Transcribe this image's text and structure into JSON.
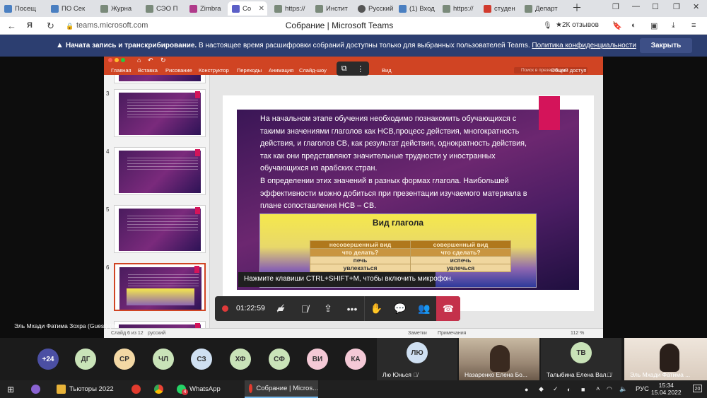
{
  "browser": {
    "tabs": [
      {
        "label": "Посещ",
        "color": "#4a7fc1"
      },
      {
        "label": "ПО Сек",
        "color": "#4a7fc1"
      },
      {
        "label": "Журна",
        "color": "#7a8a7a"
      },
      {
        "label": "СЭО П",
        "color": "#7a8a7a"
      },
      {
        "label": "Zimbra",
        "color": "#b03a8a"
      },
      {
        "label": "Со",
        "color": "#5b5fc7"
      },
      {
        "label": "https://",
        "color": "#7a8a7a"
      },
      {
        "label": "Инстит",
        "color": "#7a8a7a"
      },
      {
        "label": "Русский",
        "color": "#555"
      },
      {
        "label": "(1) Вход",
        "color": "#4a7fc1"
      },
      {
        "label": "https://",
        "color": "#7a8a7a"
      },
      {
        "label": "студен",
        "color": "#d13b2e"
      },
      {
        "label": "Департ",
        "color": "#7a8a7a"
      }
    ],
    "url": "teams.microsoft.com",
    "page_title": "Собрание | Microsoft Teams",
    "reviews": "★2К отзывов"
  },
  "banner": {
    "lead": "Начата запись и транскрибирование.",
    "text": " В настоящее время расшифровки собраний доступны только для выбранных пользователей Teams. ",
    "link": "Политика конфиденциальности",
    "close_label": "Закрыть"
  },
  "ppt": {
    "ribbon": [
      "Главная",
      "Вставка",
      "Рисование",
      "Конструктор",
      "Переходы",
      "Анимация",
      "Слайд-шоу",
      "Вид"
    ],
    "search_placeholder": "Поиск в презентации",
    "share_label": "Общий доступ",
    "thumb_numbers": [
      "3",
      "4",
      "5",
      "6"
    ],
    "slide_paragraphs": [
      "На начальном этапе обучения необходимо познакомить обучающихся с такими значениями глаголов как НСВ,процесс действия, многократность действия, и глаголов СВ, как результат действия, однократность действия, так как они представляют значительные трудности у иностранных обучающихся из арабских стран.",
      " В определении этих значений в разных формах глагола. Наибольшей эффективности можно добиться при презентации изучаемого материала в плане сопоставления НСВ – СВ."
    ],
    "table_title": "Вид глагола",
    "table": {
      "header": [
        "несовершенный вид",
        "совершенный вид"
      ],
      "question": [
        "что делать?",
        "что сделать?"
      ],
      "row1": [
        "печь",
        "испечь"
      ],
      "row2": [
        "увлекаться",
        "увлечься"
      ]
    },
    "status": {
      "slide": "Слайд 6 из 12",
      "lang": "русский",
      "notes": "Заметки",
      "comments": "Примечания",
      "zoom": "112 %"
    }
  },
  "teams": {
    "mic_toast": "Нажмите клавиши CTRL+SHIFT+M, чтобы включить микрофон.",
    "presenter": "Эль Мхади Фатима Зохра (Guest) (п",
    "timer": "01:22:59"
  },
  "participants": {
    "overflow": "+24",
    "avatars": [
      {
        "initials": "ДГ",
        "color": "#c9e3b8"
      },
      {
        "initials": "СР",
        "color": "#f3d8a4"
      },
      {
        "initials": "ЧЛ",
        "color": "#c9e3b8"
      },
      {
        "initials": "СЗ",
        "color": "#cfe0f2"
      },
      {
        "initials": "ХФ",
        "color": "#c9e3b8"
      },
      {
        "initials": "СФ",
        "color": "#c9e3b8"
      },
      {
        "initials": "ВИ",
        "color": "#f4c9d6"
      },
      {
        "initials": "КА",
        "color": "#f4c9d6"
      }
    ],
    "tiles": [
      {
        "initials": "ЛЮ",
        "name": "Лю Юнься"
      },
      {
        "initials": "",
        "name": "Назаренко Елена Бо..."
      },
      {
        "initials": "ТВ",
        "name": "Талыбина Елена Вал..."
      },
      {
        "initials": "",
        "name": "Эль Мхади Фатима ..."
      }
    ]
  },
  "taskbar": {
    "items": [
      "Тьюторы 2022",
      "WhatsApp",
      "Собрание | Micros..."
    ],
    "whatsapp_badge": "4",
    "lang": "РУС",
    "time": "15:34",
    "date": "15.04.2022",
    "notif": "20"
  }
}
